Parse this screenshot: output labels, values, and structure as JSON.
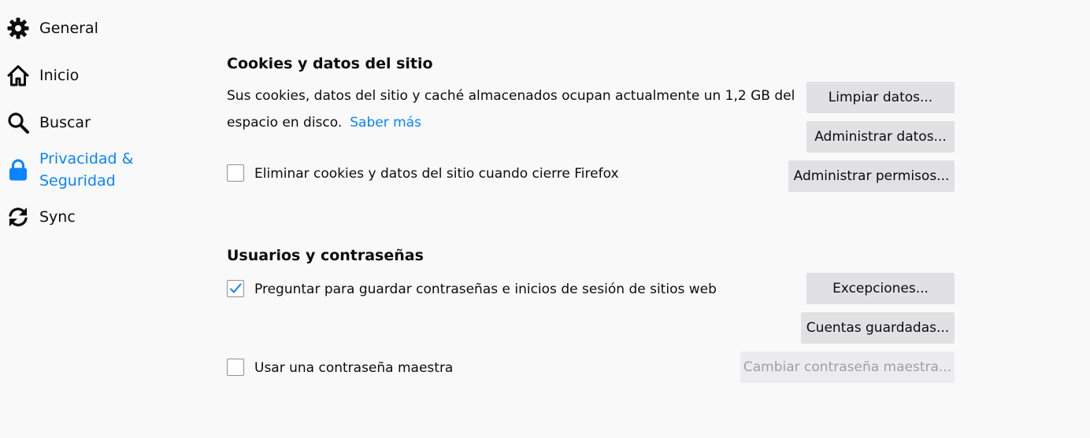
{
  "sidebar": {
    "items": [
      {
        "label": "General",
        "icon": "gear-icon"
      },
      {
        "label": "Inicio",
        "icon": "home-icon"
      },
      {
        "label": "Buscar",
        "icon": "search-icon"
      },
      {
        "label_line1": "Privacidad &",
        "label_line2": "Seguridad",
        "icon": "lock-icon",
        "selected": true
      },
      {
        "label": "Sync",
        "icon": "sync-icon"
      }
    ]
  },
  "cookies": {
    "title": "Cookies y datos del sitio",
    "description_line1": "Sus cookies, datos del sitio y caché almacenados ocupan actualmente un 1,2 GB del",
    "description_line2": "espacio en disco.",
    "learn_more": "Saber más",
    "delete_on_close_label": "Eliminar cookies y datos del sitio cuando cierre Firefox",
    "delete_on_close_checked": false,
    "clear_data_button": "Limpiar datos...",
    "manage_data_button": "Administrar datos...",
    "manage_permissions_button": "Administrar permisos..."
  },
  "logins": {
    "title": "Usuarios y contraseñas",
    "ask_to_save_label": "Preguntar para guardar contraseñas e inicios de sesión de sitios web",
    "ask_to_save_checked": true,
    "exceptions_button": "Excepciones...",
    "saved_logins_button": "Cuentas guardadas...",
    "master_password_label": "Usar una contraseña maestra",
    "master_password_checked": false,
    "change_master_password_button": "Cambiar contraseña maestra..."
  },
  "colors": {
    "accent": "#0a84ff",
    "background": "#f9f9fa",
    "button": "#e1e1e3"
  }
}
